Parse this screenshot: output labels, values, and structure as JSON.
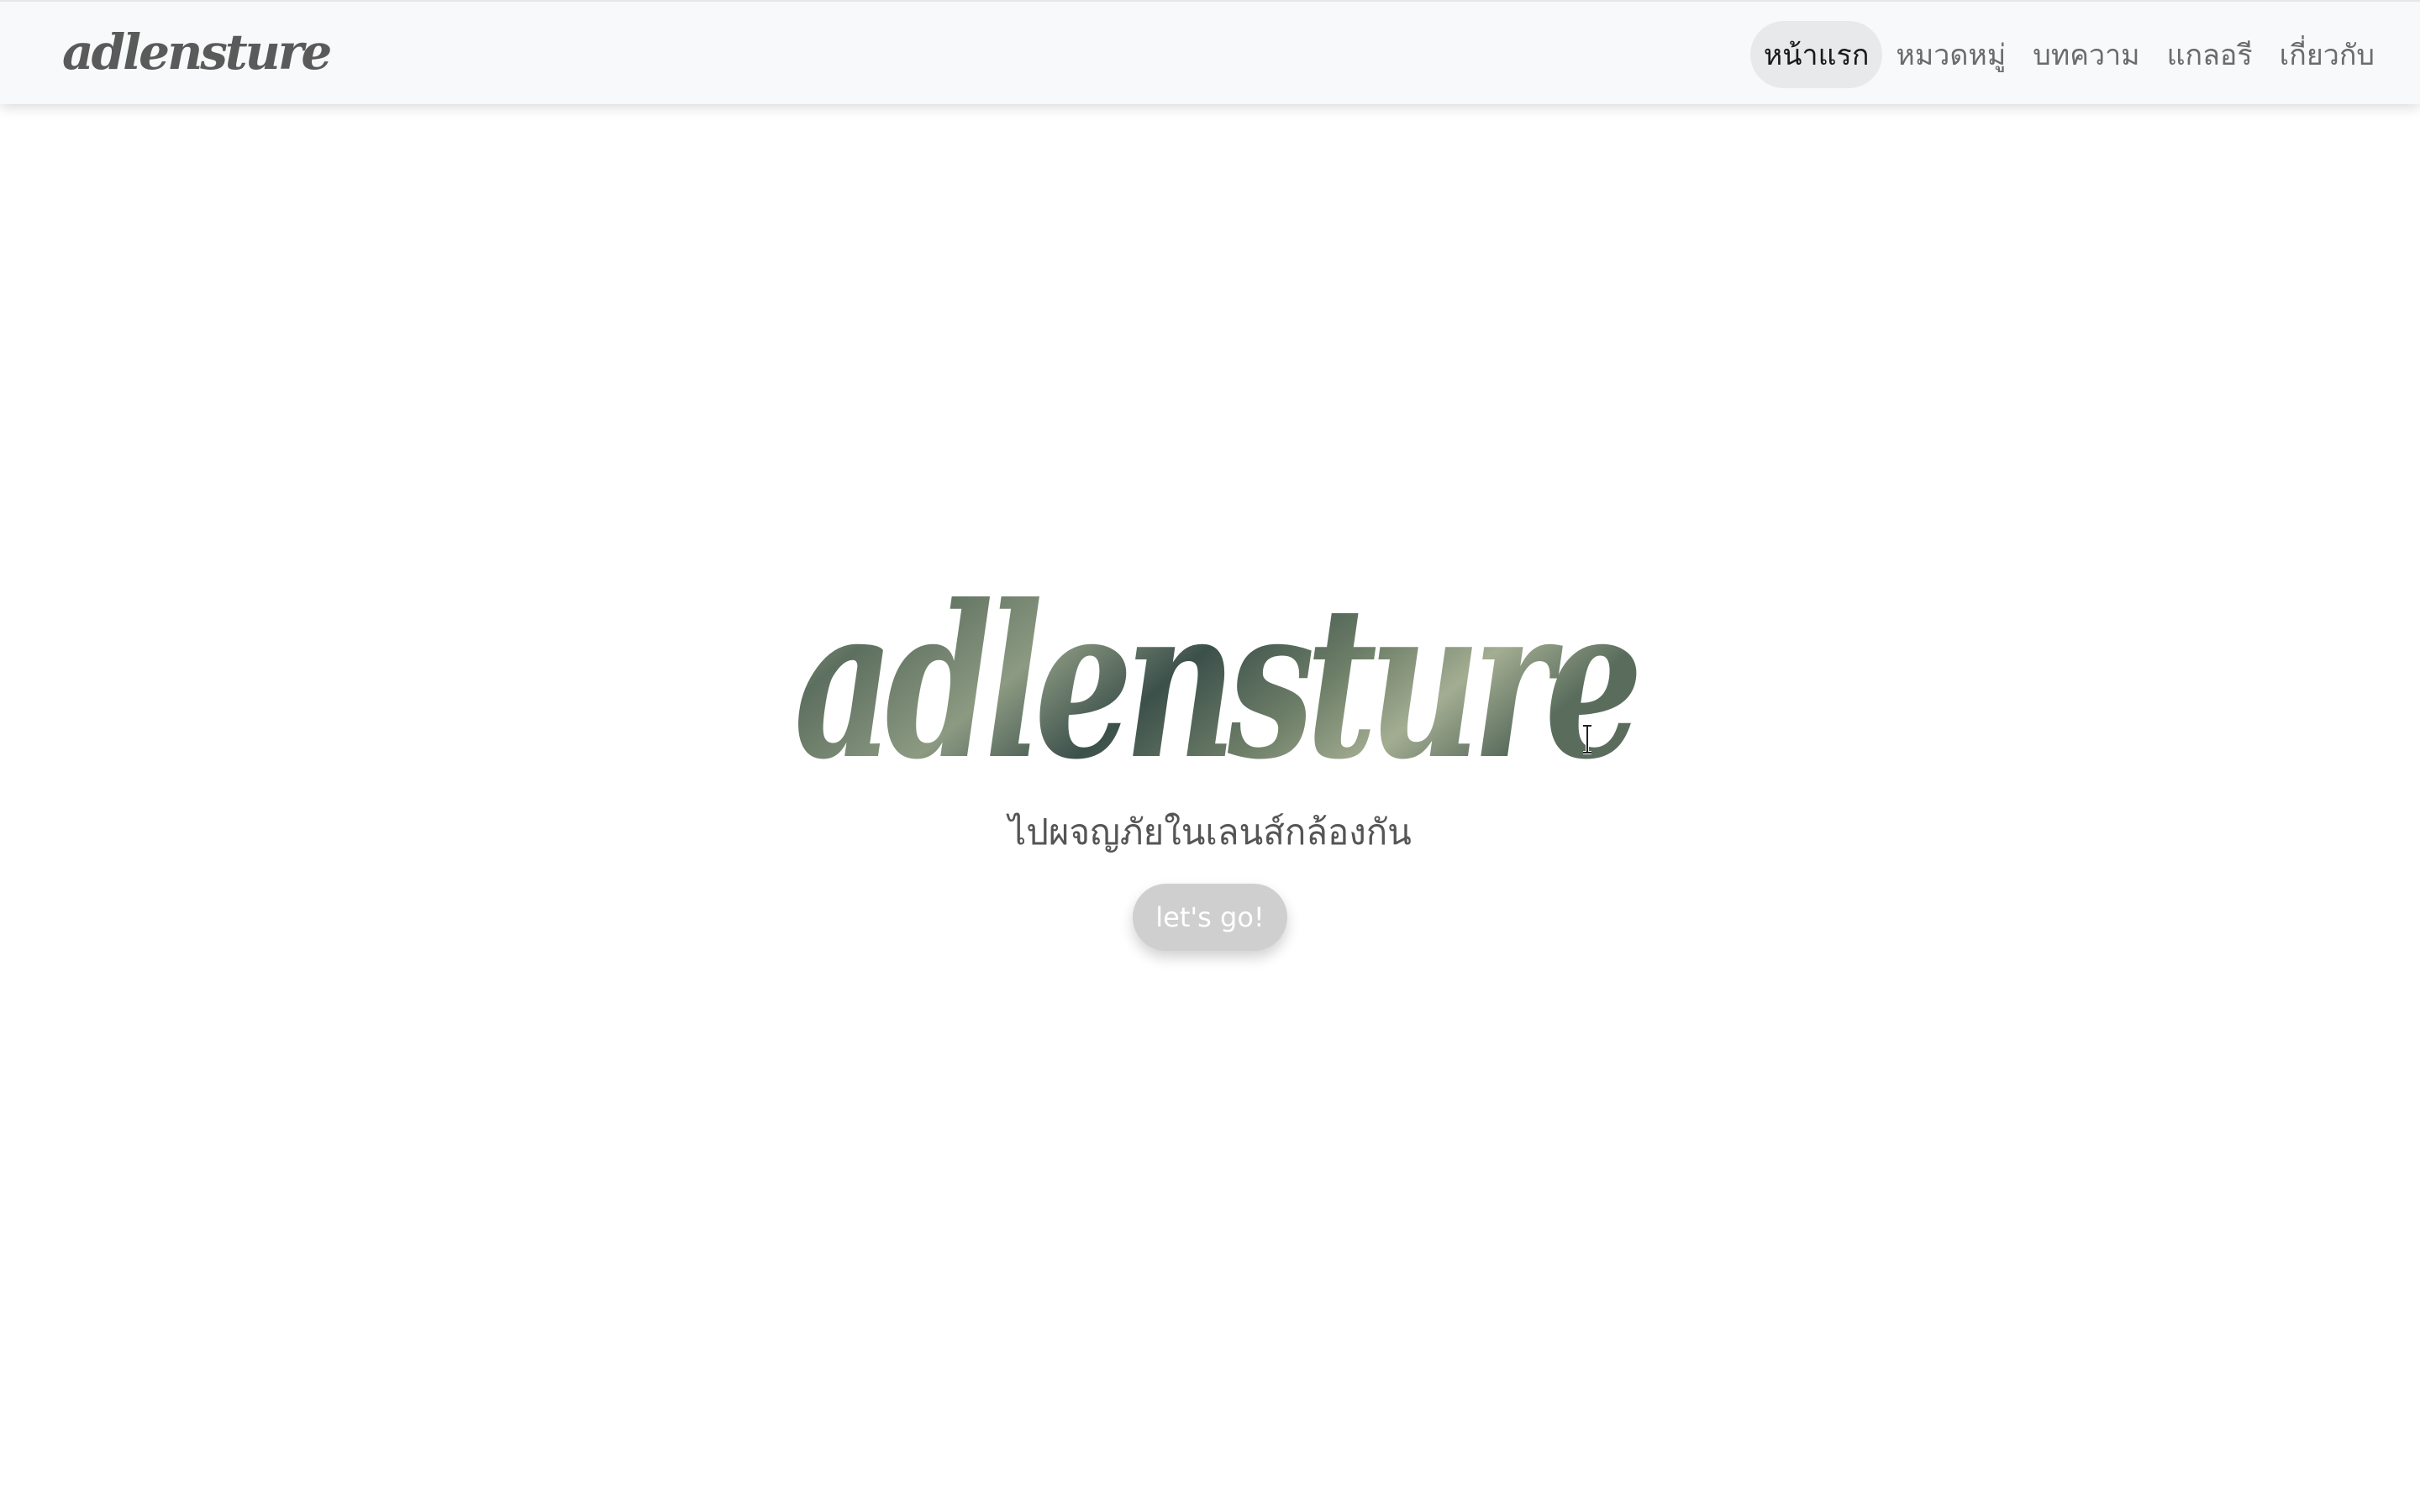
{
  "navbar": {
    "brand": "adlensture",
    "items": [
      {
        "label": "หน้าแรก",
        "active": true
      },
      {
        "label": "หมวดหมู่",
        "active": false
      },
      {
        "label": "บทความ",
        "active": false
      },
      {
        "label": "แกลอรี",
        "active": false
      },
      {
        "label": "เกี่ยวกับ",
        "active": false
      }
    ]
  },
  "hero": {
    "title": "adlensture",
    "tagline": "ไปผจญภัยในเลนส์กล้องกัน",
    "cta_label": "let's go!"
  },
  "colors": {
    "navbar_bg": "#f8f9fa",
    "title_gradient": [
      "#a4ad90",
      "#556b5b",
      "#3e5450",
      "#8a9a7e"
    ],
    "cta_bg": "#cfcfcf"
  },
  "icons": {
    "cursor": "text-cursor-icon"
  }
}
